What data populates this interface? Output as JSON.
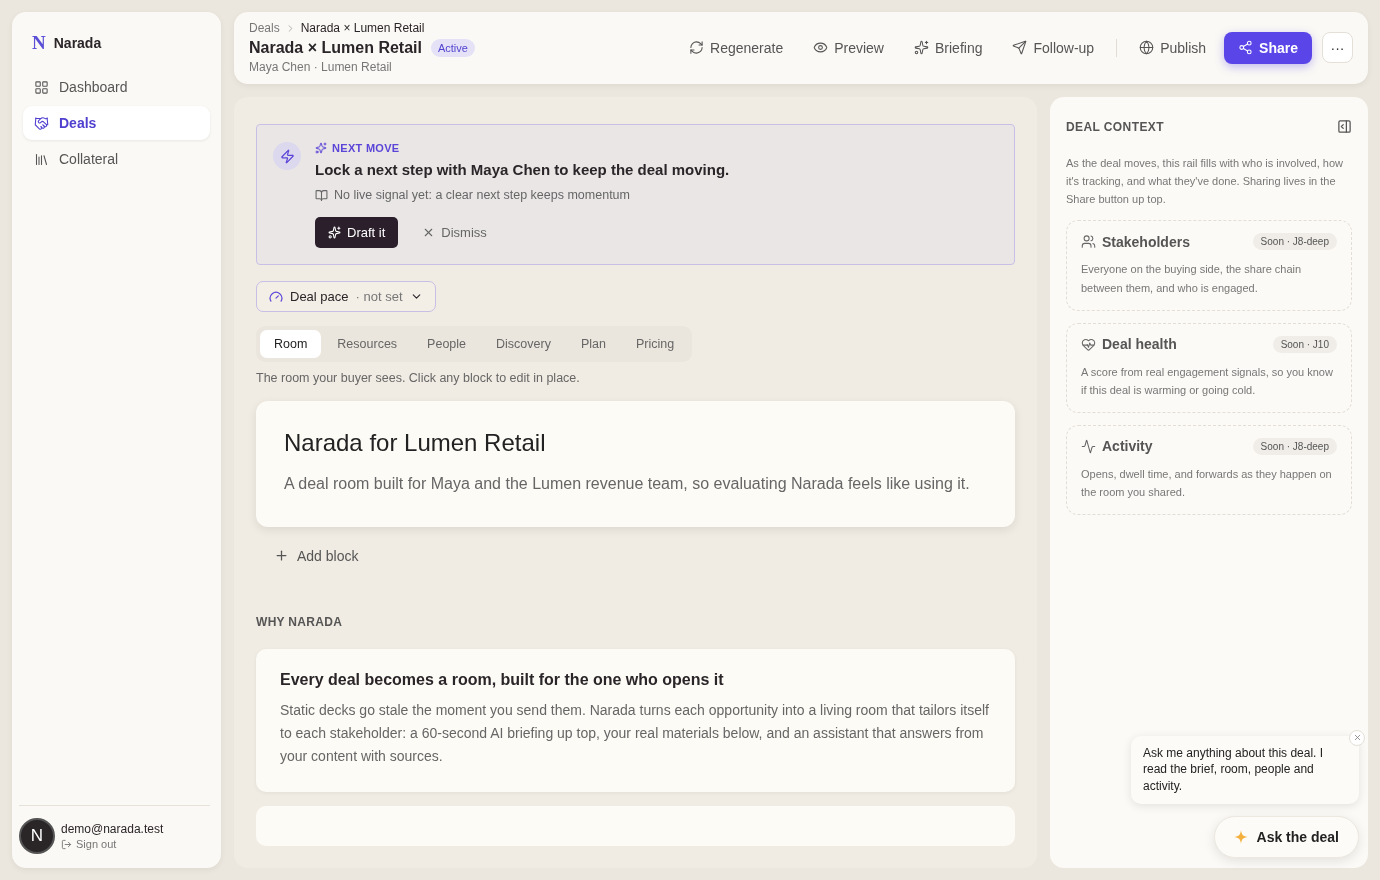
{
  "sidebar": {
    "brand": {
      "mark": "N",
      "name": "Narada"
    },
    "items": [
      {
        "label": "Dashboard",
        "selected": false
      },
      {
        "label": "Deals",
        "selected": true
      },
      {
        "label": "Collateral",
        "selected": false
      }
    ],
    "user": {
      "avatar": "N",
      "email": "demo@narada.test",
      "sign_out": "Sign out"
    }
  },
  "header": {
    "breadcrumb": [
      "Deals",
      "Narada × Lumen Retail"
    ],
    "title": "Narada × Lumen Retail",
    "status": "Active",
    "subtitle": "Maya Chen · Lumen Retail",
    "actions": [
      {
        "label": "Regenerate",
        "kind": "ghost"
      },
      {
        "label": "Preview",
        "kind": "ghost"
      },
      {
        "label": "Briefing",
        "kind": "ghost"
      },
      {
        "label": "Follow-up",
        "kind": "ghost"
      },
      {
        "label": "Publish",
        "kind": "ghost"
      },
      {
        "label": "Share",
        "kind": "primary"
      },
      {
        "label": "···",
        "kind": "more"
      }
    ]
  },
  "next_move": {
    "eyebrow": "NEXT MOVE",
    "title": "Lock a next step with Maya Chen to keep the deal moving.",
    "note": "No live signal yet: a clear next step keeps momentum",
    "primary": "Draft it",
    "secondary": "Dismiss"
  },
  "deal_pace": {
    "label": "Deal pace",
    "value": "· not set"
  },
  "tabs": [
    {
      "label": "Room",
      "selected": true
    },
    {
      "label": "Resources",
      "selected": false
    },
    {
      "label": "People",
      "selected": false
    },
    {
      "label": "Discovery",
      "selected": false
    },
    {
      "label": "Plan",
      "selected": false
    },
    {
      "label": "Pricing",
      "selected": false
    }
  ],
  "tab_hint": "The room your buyer sees. Click any block to edit in place.",
  "hero": {
    "title": "Narada for Lumen Retail",
    "body": "A deal room built for Maya and the Lumen revenue team, so evaluating Narada feels like using it."
  },
  "add_block": "Add block",
  "section": {
    "heading": "WHY NARADA",
    "title": "Every deal becomes a room, built for the one who opens it",
    "body": "Static decks go stale the moment you send them. Narada turns each opportunity into a living room that tailors itself to each stakeholder: a 60-second AI briefing up top, your real materials below, and an assistant that answers from your content with sources."
  },
  "rail": {
    "title": "DEAL CONTEXT",
    "intro": "As the deal moves, this rail fills with who is involved, how it's tracking, and what they've done. Sharing lives in the Share button up top.",
    "cards": [
      {
        "title": "Stakeholders",
        "badge": "Soon · J8-deep",
        "body": "Everyone on the buying side, the share chain between them, and who is engaged."
      },
      {
        "title": "Deal health",
        "badge": "Soon · J10",
        "body": "A score from real engagement signals, so you know if this deal is warming or going cold."
      },
      {
        "title": "Activity",
        "badge": "Soon · J8-deep",
        "body": "Opens, dwell time, and forwards as they happen on the room you shared."
      }
    ]
  },
  "assistant": {
    "message": "Ask me anything about this deal. I read the brief, room, people and activity.",
    "button": "Ask the deal"
  }
}
